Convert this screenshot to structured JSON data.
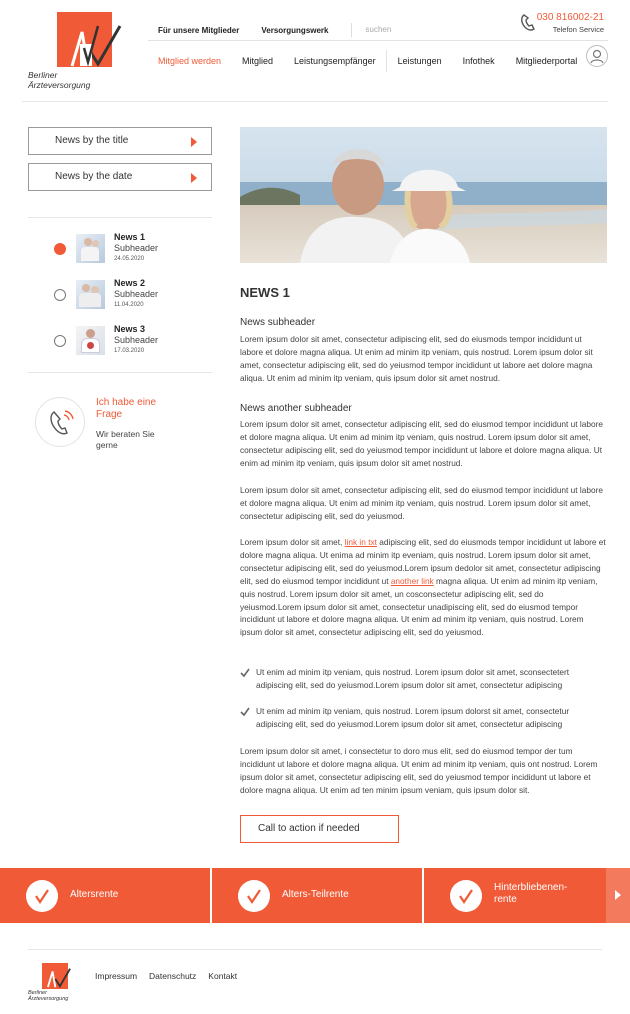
{
  "header": {
    "logo_text_1": "Berliner",
    "logo_text_2": "Ärzteversorgung",
    "top_links": [
      "Für unsere Mitglieder",
      "Versorgungswerk"
    ],
    "search_placeholder": "suchen",
    "phone_number": "030 816002-21",
    "phone_label": "Telefon Service",
    "nav": [
      "Mitglied werden",
      "Mitglied",
      "Leistungsempfänger",
      "Leistungen",
      "Infothek",
      "Mitgliederportal"
    ]
  },
  "sidebar": {
    "buttons": [
      "News by the title",
      "News by the date"
    ],
    "news": [
      {
        "title": "News 1",
        "sub": "Subheader",
        "date": "24.05.2020"
      },
      {
        "title": "News 2",
        "sub": "Subheader",
        "date": "11.04.2020"
      },
      {
        "title": "News 3",
        "sub": "Subheader",
        "date": "17.03.2020"
      }
    ],
    "call_title": "Ich habe eine Frage",
    "call_sub": "Wir beraten Sie gerne"
  },
  "article": {
    "title": "NEWS 1",
    "subheader_1": "News subheader",
    "para_1": "Lorem ipsum dolor sit amet, consectetur adipiscing elit, sed do eiusmods tempor incididunt ut labore et dolore magna aliqua. Ut enim ad minim itp veniam, quis nostrud. Lorem ipsum dolor sit amet, consectetur adipiscing elit, sed do yeiusmod tempor incididunt ut labore aet dolore magna aliqua. Ut enim ad minim itp veniam, quis ipsum dolor sit amet nostrud.",
    "subheader_2": "News another subheader",
    "para_2": "Lorem ipsum dolor sit amet, consectetur adipiscing elit, sed do eiusmod tempor incididunt ut labore et dolore magna aliqua. Ut enim ad minim itp veniam, quis nostrud. Lorem ipsum dolor sit amet, consectetur adipiscing elit, sed do yeiusmod tempor incididunt ut labore et dolore magna aliqua. Ut enim ad minim itp veniam, quis ipsum dolor sit amet nostrud.",
    "para_3": "Lorem ipsum dolor sit amet, consectetur adipiscing elit, sed do eiusmod tempor incididunt ut labore et dolore magna aliqua. Ut enim ad minim itp veniam, quis nostrud. Lorem ipsum dolor sit amet, consectetur adipiscing elit, sed do yeiusmod.",
    "para_4_a": "Lorem ipsum dolor sit amet, ",
    "link_1": "link in txt",
    "para_4_b": " adipiscing elit, sed do eiusmods tempor incididunt ut labore et dolore magna aliqua. Ut enima ad minim itp eveniam, quis nostrud. Lorem ipsum dolor sit amet, consectetur adipiscing elit, sed do yeiusmod.Lorem ipsum dedolor sit amet, consectetur adipiscing elit, sed do eiusmod tempor incididunt ut ",
    "link_2": "another link",
    "para_4_c": " magna aliqua. Ut enim ad minim itp veniam, quis nostrud. Lorem ipsum dolor sit amet, un cosconsectetur adipiscing elit, sed do yeiusmod.Lorem ipsum dolor sit amet, consectetur unadipiscing elit, sed do eiusmod tempor incididunt ut labore et dolore magna aliqua. Ut enim ad minim itp veniam, quis nostrud. Lorem ipsum dolor sit amet, consectetur adipiscing elit, sed do yeiusmod.",
    "check_1": "Ut enim ad minim itp veniam, quis nostrud. Lorem ipsum dolor sit amet, sconsectetert adipiscing elit, sed do yeiusmod.Lorem ipsum dolor sit amet, consectetur adipiscing",
    "check_2": "Ut enim ad minim itp veniam, quis nostrud. Lorem ipsum dolorst sit amet, consectetur adipiscing elit, sed do yeiusmod.Lorem ipsum dolor sit amet, consectetur adipiscing",
    "para_5": "Lorem ipsum dolor sit amet, i consectetur to doro mus elit, sed do eiusmod tempor der tum incididunt ut labore et dolore magna aliqua. Ut enim ad minim itp veniam, quis ont nostrud. Lorem ipsum dolor sit amet, consectetur adipiscing elit, sed do yeiusmod tempor incididunt ut labore et dolore magna aliqua. Ut enim ad ten minim ipsum veniam, quis ipsum dolor sit.",
    "cta": "Call to action if needed"
  },
  "band": [
    "Altersrente",
    "Alters-Teilrente",
    "Hinterbliebenen-rente"
  ],
  "footer": {
    "logo_text_1": "Berliner",
    "logo_text_2": "Ärzteversorgung",
    "links": [
      "Impressum",
      "Datenschutz",
      "Kontakt"
    ]
  },
  "colors": {
    "accent": "#f15a37"
  }
}
